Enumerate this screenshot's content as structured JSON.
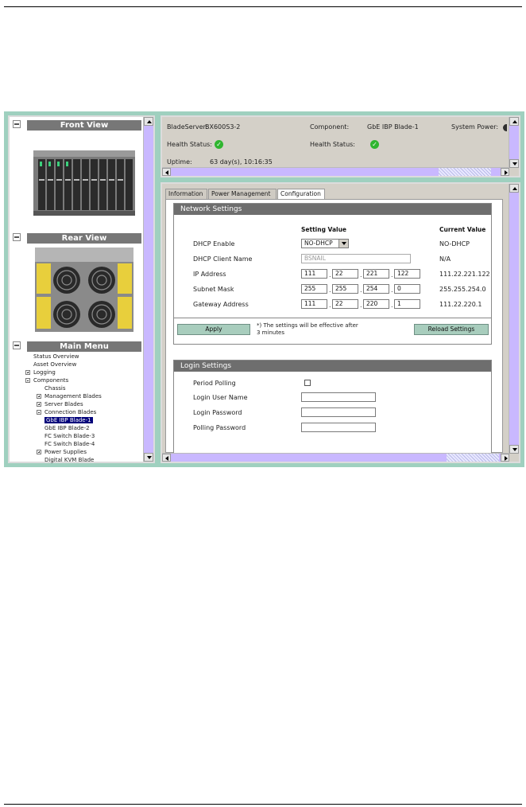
{
  "left_panel": {
    "front_view_title": "Front View",
    "rear_view_title": "Rear View",
    "main_menu_title": "Main Menu",
    "menu": [
      {
        "label": "Status Overview",
        "indent": 0,
        "toggle": "none"
      },
      {
        "label": "Asset Overview",
        "indent": 0,
        "toggle": "none"
      },
      {
        "label": "Logging",
        "indent": 0,
        "toggle": "plus"
      },
      {
        "label": "Components",
        "indent": 0,
        "toggle": "minus"
      },
      {
        "label": "Chassis",
        "indent": 1,
        "toggle": "none"
      },
      {
        "label": "Management Blades",
        "indent": 1,
        "toggle": "plus"
      },
      {
        "label": "Server Blades",
        "indent": 1,
        "toggle": "plus"
      },
      {
        "label": "Connection Blades",
        "indent": 1,
        "toggle": "minus"
      },
      {
        "label": "GbE IBP Blade-1",
        "indent": 2,
        "toggle": "none",
        "selected": true
      },
      {
        "label": "GbE IBP Blade-2",
        "indent": 2,
        "toggle": "none"
      },
      {
        "label": "FC Switch Blade-3",
        "indent": 2,
        "toggle": "none"
      },
      {
        "label": "FC Switch Blade-4",
        "indent": 2,
        "toggle": "none"
      },
      {
        "label": "Power Supplies",
        "indent": 1,
        "toggle": "plus"
      },
      {
        "label": "Digital KVM Blade",
        "indent": 1,
        "toggle": "none"
      }
    ]
  },
  "status": {
    "bladeserver_label": "BladeServer:",
    "bladeserver_value": "BX600S3-2",
    "component_label": "Component:",
    "component_value": "GbE IBP Blade-1",
    "system_power_label": "System Power:",
    "health_label_1": "Health Status:",
    "health_label_2": "Health Status:",
    "uptime_label": "Uptime:",
    "uptime_value": "63 day(s), 10:16:35",
    "health_icon": "check-circle",
    "health_color": "#2fb52f"
  },
  "tabs": [
    {
      "label": "Information",
      "active": false
    },
    {
      "label": "Power Management",
      "active": false
    },
    {
      "label": "Configuration",
      "active": true
    }
  ],
  "network": {
    "title": "Network Settings",
    "setting_value_header": "Setting Value",
    "current_value_header": "Current Value",
    "dhcp_enable_label": "DHCP Enable",
    "dhcp_enable_value": "NO-DHCP",
    "dhcp_enable_current": "NO-DHCP",
    "dhcp_client_label": "DHCP Client Name",
    "dhcp_client_value": "BSNAIL",
    "dhcp_client_current": "N/A",
    "ip_label": "IP Address",
    "ip": [
      "111",
      "22",
      "221",
      "122"
    ],
    "ip_current": "111.22.221.122",
    "mask_label": "Subnet Mask",
    "mask": [
      "255",
      "255",
      "254",
      "0"
    ],
    "mask_current": "255.255.254.0",
    "gw_label": "Gateway Address",
    "gw": [
      "111",
      "22",
      "220",
      "1"
    ],
    "gw_current": "111.22.220.1",
    "apply_label": "Apply",
    "note": "*) The settings will be effective after 3 minutes",
    "reload_label": "Reload Settings"
  },
  "login": {
    "title": "Login Settings",
    "period_polling_label": "Period Polling",
    "user_label": "Login User Name",
    "password_label": "Login Password",
    "polling_password_label": "Polling Password"
  },
  "colors": {
    "frame": "#9fd0bf",
    "scrollbar": "#c9b8ff",
    "button": "#a8cdbd",
    "group_title": "#6e6e6e",
    "selection": "#00007a"
  }
}
